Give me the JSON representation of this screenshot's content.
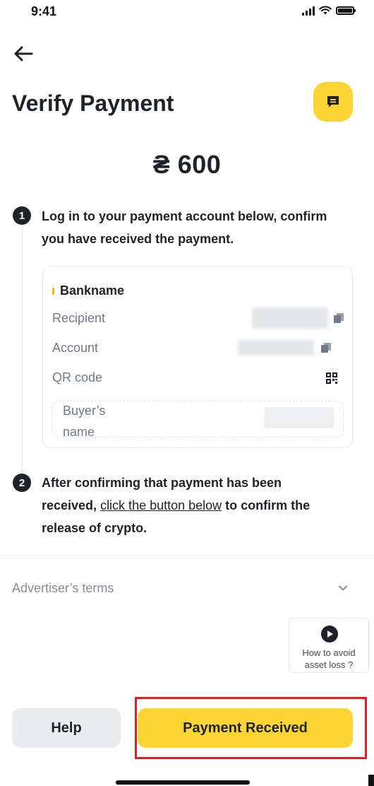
{
  "status_bar": {
    "time": "9:41"
  },
  "header": {
    "title": "Verify Payment"
  },
  "amount": "₴ 600",
  "steps": [
    {
      "number": "1",
      "line1": "Log in to your payment account below, confirm",
      "line2": "you have received the payment."
    },
    {
      "number": "2",
      "line1": "After confirming that payment has been",
      "line2_prefix": "received, ",
      "line2_link": "click the button below",
      "line2_suffix": " to confirm the",
      "line3": "release of crypto."
    }
  ],
  "payment_card": {
    "bank_name": "Bankname",
    "recipient_label": "Recipient",
    "account_label": "Account",
    "qr_label": "QR code",
    "buyer_label": "Buyer’s name"
  },
  "terms": {
    "label": "Advertiser’s terms"
  },
  "asset_loss": {
    "line1": "How to avoid",
    "line2": "asset loss ?"
  },
  "actions": {
    "help_label": "Help",
    "received_label": "Payment Received"
  },
  "colors": {
    "accent": "#fcd535",
    "text": "#1e2329",
    "muted": "#707a8a",
    "highlight": "#e02020"
  }
}
